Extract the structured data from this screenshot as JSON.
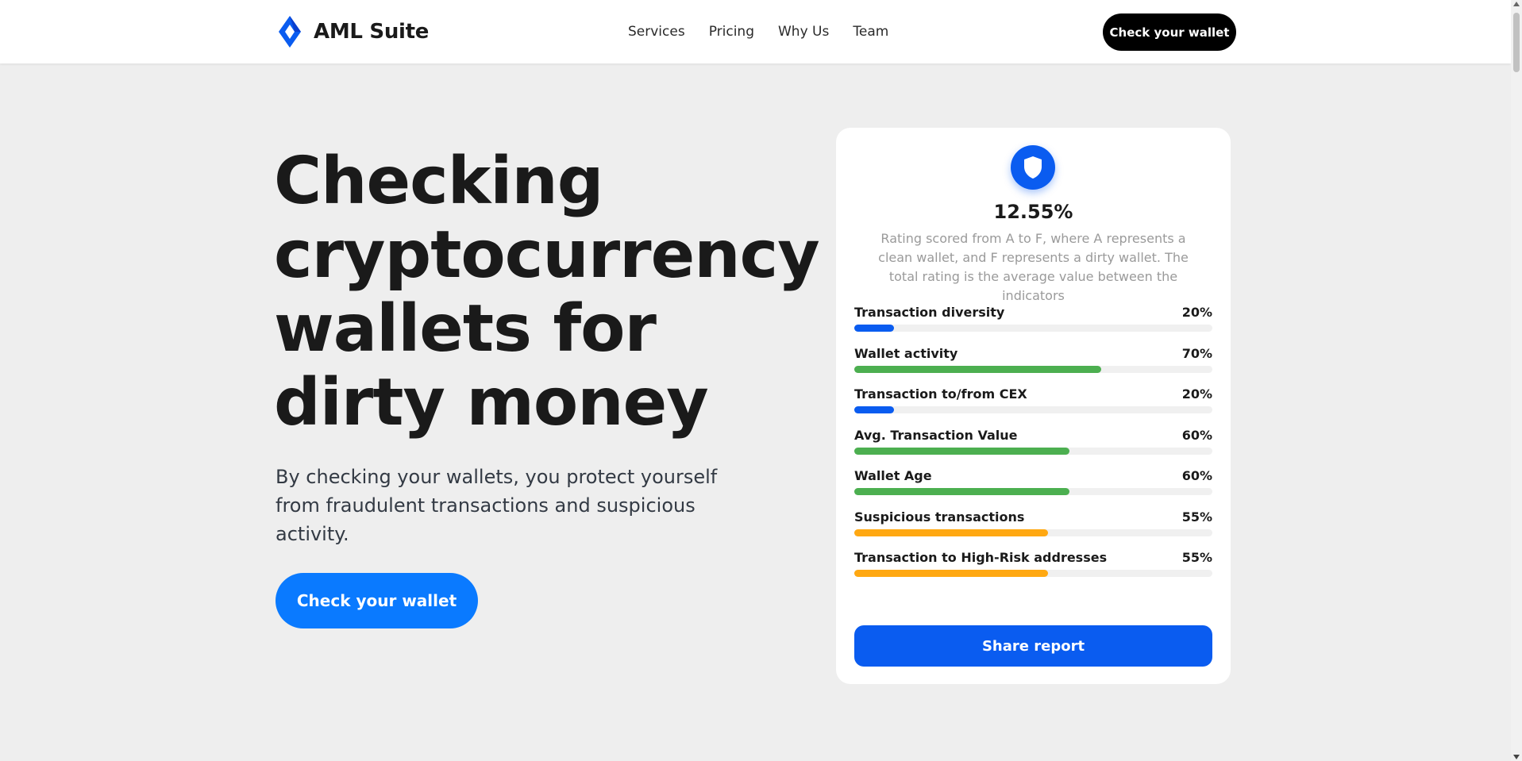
{
  "header": {
    "brand": "AML Suite",
    "nav": [
      "Services",
      "Pricing",
      "Why Us",
      "Team"
    ],
    "cta_label": "Check your wallet"
  },
  "hero": {
    "title_lines": [
      "Checking",
      "cryptocurrency",
      "wallets for",
      "dirty money"
    ],
    "subtitle": "By checking your wallets, you protect yourself from fraudulent transactions and suspicious activity.",
    "cta_label": "Check your wallet"
  },
  "card": {
    "score": "12.55%",
    "description": "Rating scored from A to F, where A represents a clean wallet, and F represents a dirty wallet. The total rating is the average value between the indicators",
    "metrics": [
      {
        "label": "Transaction diversity",
        "value": "20%",
        "fraction": 0.11,
        "color": "#0a5cf0"
      },
      {
        "label": "Wallet activity",
        "value": "70%",
        "fraction": 0.69,
        "color": "#4caf50"
      },
      {
        "label": "Transaction to/from CEX",
        "value": "20%",
        "fraction": 0.11,
        "color": "#0a5cf0"
      },
      {
        "label": "Avg. Transaction Value",
        "value": "60%",
        "fraction": 0.6,
        "color": "#4caf50"
      },
      {
        "label": "Wallet Age",
        "value": "60%",
        "fraction": 0.6,
        "color": "#4caf50"
      },
      {
        "label": "Suspicious transactions",
        "value": "55%",
        "fraction": 0.54,
        "color": "#ffa812"
      },
      {
        "label": "Transaction to High-Risk addresses",
        "value": "55%",
        "fraction": 0.54,
        "color": "#ffa812"
      }
    ],
    "share_label": "Share report"
  },
  "colors": {
    "brand_blue": "#0a5cf0",
    "cta_blue": "#0a7aff",
    "good": "#4caf50",
    "warning": "#ffa812"
  },
  "icons": {
    "logo": "diamond-logo-icon",
    "shield": "shield-icon"
  }
}
